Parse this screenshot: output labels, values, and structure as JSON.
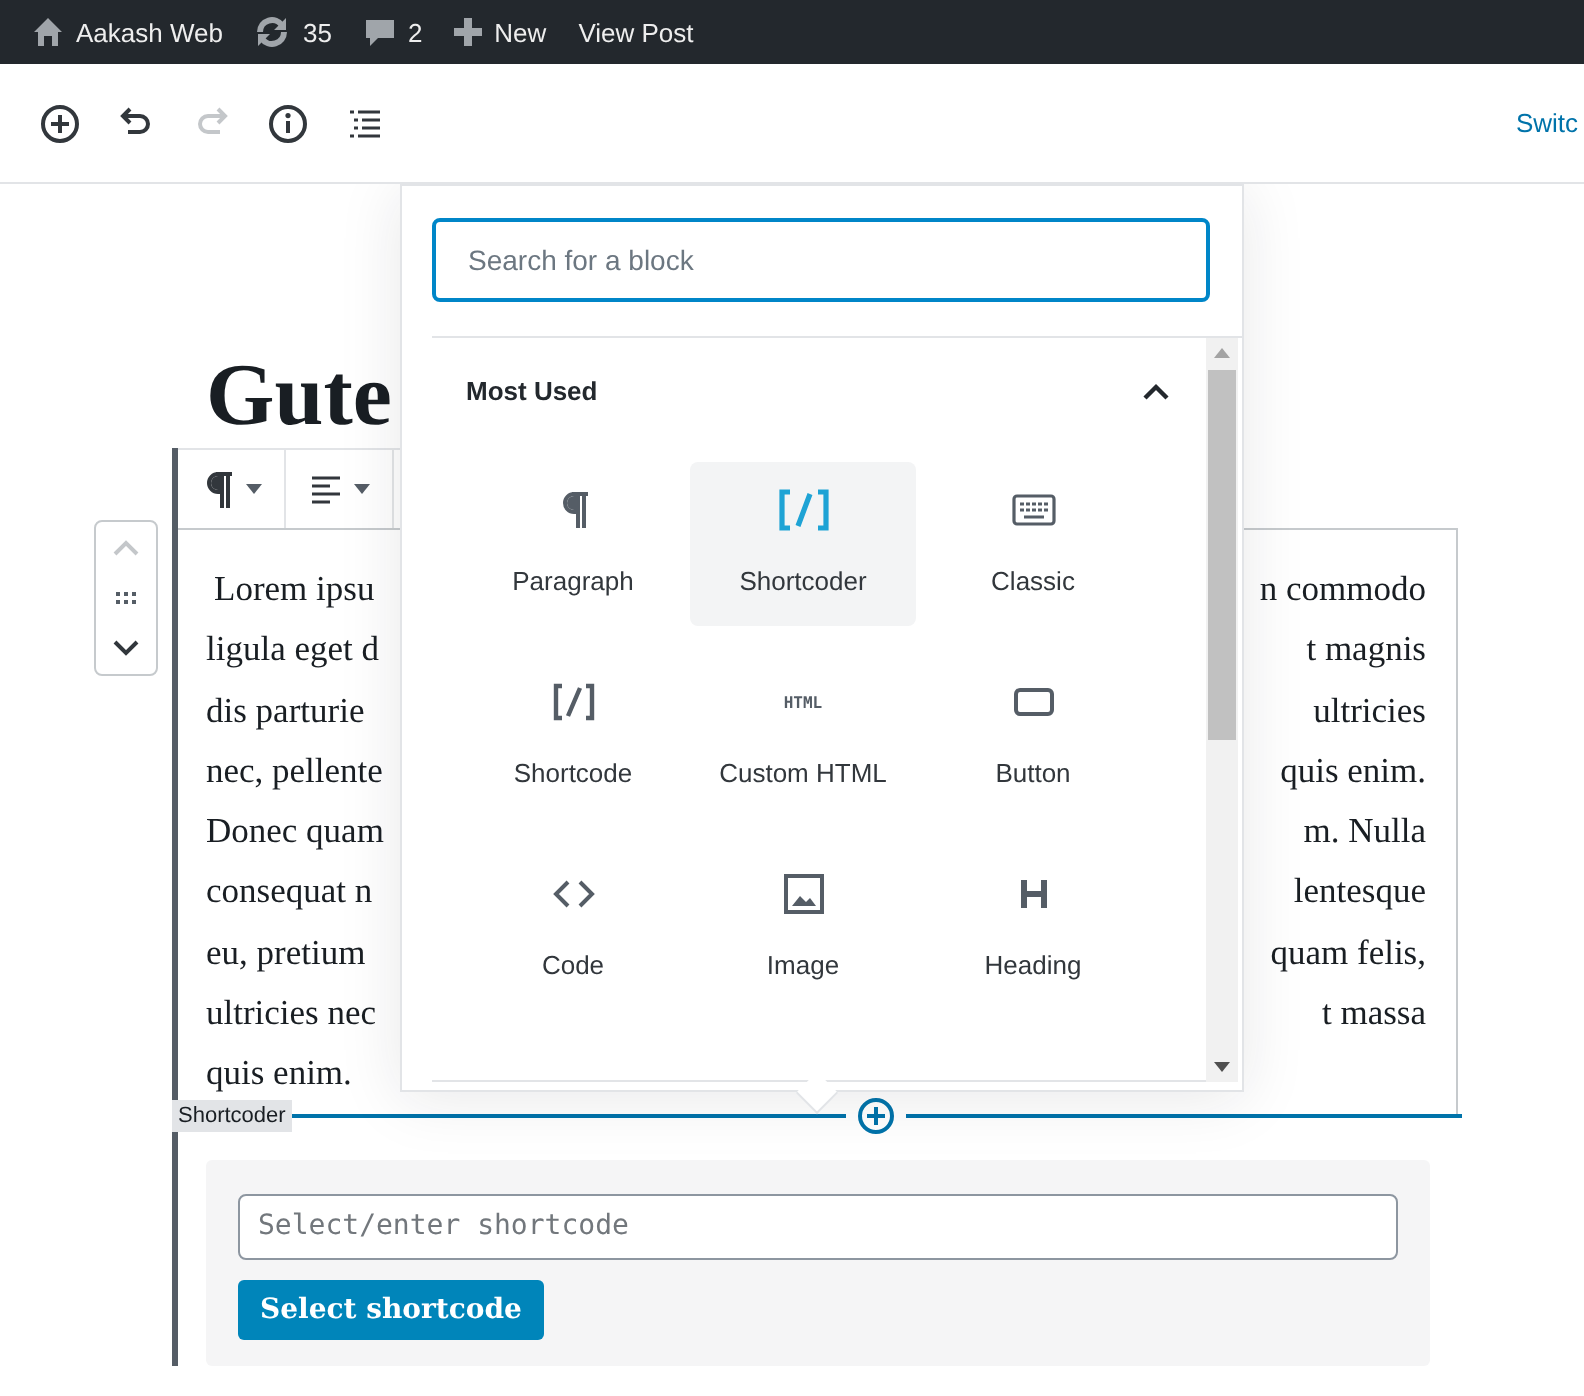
{
  "admin_bar": {
    "items": [
      {
        "kind": "home",
        "label": "Aakash Web"
      },
      {
        "kind": "updates",
        "label": "35"
      },
      {
        "kind": "comments",
        "label": "2"
      },
      {
        "kind": "new",
        "label": "New"
      },
      {
        "kind": "plain",
        "label": "View Post"
      }
    ]
  },
  "editor_toolbar": {
    "buttons": [
      {
        "kind": "add",
        "disabled": false
      },
      {
        "kind": "undo",
        "disabled": false
      },
      {
        "kind": "redo",
        "disabled": true
      },
      {
        "kind": "info",
        "disabled": false
      },
      {
        "kind": "outline",
        "disabled": false
      }
    ],
    "switch_link": "Switc"
  },
  "post_title": "Gute",
  "block_toolbar": [
    {
      "kind": "paragraph"
    },
    {
      "kind": "align"
    }
  ],
  "paragraph_lines": [
    {
      "left": "Lorem ipsu",
      "right": "n commodo"
    },
    {
      "left": "ligula eget d",
      "right": "t magnis"
    },
    {
      "left": "dis parturie",
      "right": "ultricies"
    },
    {
      "left": "nec, pellente",
      "right": "quis enim."
    },
    {
      "left": "Donec quam",
      "right": "m. Nulla"
    },
    {
      "left": "consequat n",
      "right": "lentesque"
    },
    {
      "left": "eu, pretium",
      "right": "quam felis,"
    },
    {
      "left": "ultricies nec",
      "right": "t massa"
    },
    {
      "left": "quis enim."
    }
  ],
  "inserter": {
    "search": {
      "placeholder": "Search for a block"
    },
    "section": {
      "title": "Most Used",
      "expanded": true
    },
    "blocks": [
      {
        "kind": "paragraph",
        "label": "Paragraph",
        "selected": false
      },
      {
        "kind": "shortcoder",
        "label": "Shortcoder",
        "selected": true
      },
      {
        "kind": "classic",
        "label": "Classic",
        "selected": false
      },
      {
        "kind": "shortcode",
        "label": "Shortcode",
        "selected": false
      },
      {
        "kind": "html",
        "label": "Custom HTML",
        "icon_text": "HTML",
        "selected": false
      },
      {
        "kind": "button",
        "label": "Button",
        "selected": false
      },
      {
        "kind": "code",
        "label": "Code",
        "selected": false
      },
      {
        "kind": "image",
        "label": "Image",
        "selected": false
      },
      {
        "kind": "heading",
        "label": "Heading",
        "selected": false
      }
    ]
  },
  "shortcoder_block": {
    "label": "Shortcoder",
    "input_placeholder": "Select/enter shortcode",
    "button": "Select shortcode"
  }
}
